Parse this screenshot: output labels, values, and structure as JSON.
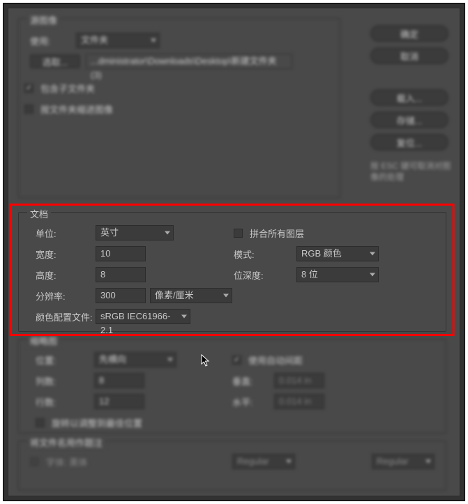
{
  "source": {
    "legend": "源图像",
    "use_label": "使用:",
    "use_value": "文件夹",
    "browse_button": "选取...",
    "path": "...dministrator\\Downloads\\Desktop\\新建文件夹 (3)",
    "cb_include_sub": {
      "checked": true,
      "label": "包含子文件夹"
    },
    "cb_thumbnail": {
      "checked": false,
      "label": "按文件夹缩进图像"
    }
  },
  "buttons": {
    "ok": "确定",
    "cancel": "取消",
    "load": "载入...",
    "save": "存储...",
    "reset": "复位..."
  },
  "esc_hint": "按 ESC 键可取消对图像的处理",
  "doc": {
    "legend": "文档",
    "unit_label": "单位:",
    "unit_value": "英寸",
    "width_label": "宽度:",
    "width_value": "10",
    "height_label": "高度:",
    "height_value": "8",
    "res_label": "分辨率:",
    "res_value": "300",
    "res_unit": "像素/厘米",
    "profile_label": "颜色配置文件:",
    "profile_value": "sRGB IEC61966-2.1",
    "cb_flatten": {
      "checked": false,
      "label": "拼合所有图层"
    },
    "mode_label": "模式:",
    "mode_value": "RGB 颜色",
    "depth_label": "位深度:",
    "depth_value": "8 位"
  },
  "thumb": {
    "legend": "缩略图",
    "pos_label": "位置:",
    "pos_value": "先横向",
    "cols_label": "列数:",
    "cols_value": "8",
    "rows_label": "行数:",
    "rows_value": "12",
    "cb_rotate": {
      "checked": false,
      "label": "旋转以调整到最佳位置"
    },
    "cb_auto": {
      "checked": true,
      "label": "使用自动间距"
    },
    "vert_label": "垂直:",
    "vert_value": "0.014 in",
    "horiz_label": "水平:",
    "horiz_value": "0.014 in"
  },
  "filename": {
    "legend": "将文件名用作题注",
    "cb": {
      "checked": false,
      "label": "字体: 黑体"
    },
    "regular1": "Regular",
    "regular2": "Regular"
  }
}
